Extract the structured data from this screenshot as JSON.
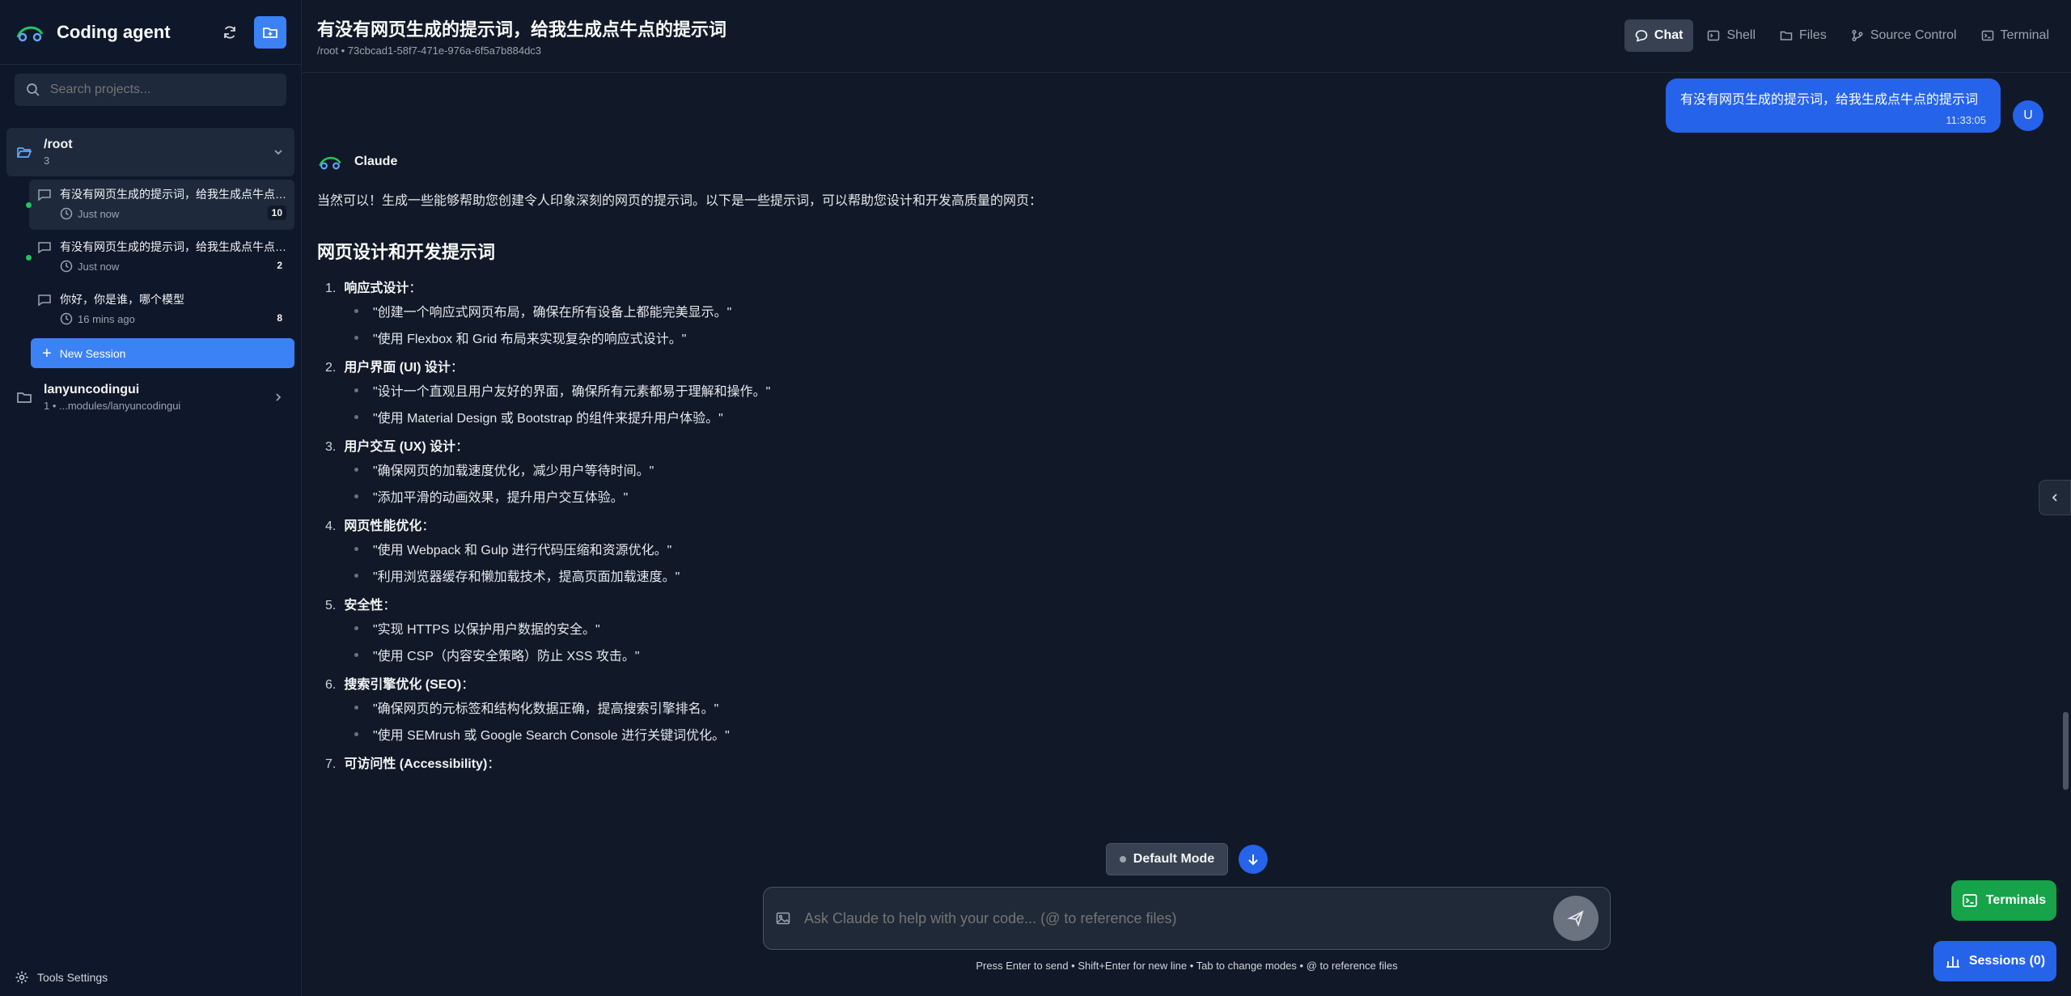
{
  "sidebar": {
    "app_title": "Coding agent",
    "search_placeholder": "Search projects...",
    "projects": [
      {
        "name": "/root",
        "count": "3"
      },
      {
        "name": "lanyuncodingui",
        "count": "1 • ...modules/lanyuncodingui"
      }
    ],
    "sessions": [
      {
        "title": "有没有网页生成的提示词，给我生成点牛点的提示词",
        "time": "Just now",
        "count": "10"
      },
      {
        "title": "有没有网页生成的提示词，给我生成点牛点的提示词",
        "time": "Just now",
        "count": "2"
      },
      {
        "title": "你好，你是谁，哪个模型",
        "time": "16 mins ago",
        "count": "8"
      }
    ],
    "new_session_label": "New Session",
    "tools_settings_label": "Tools Settings"
  },
  "header": {
    "title": "有没有网页生成的提示词，给我生成点牛点的提示词",
    "subtitle": "/root • 73cbcad1-58f7-471e-976a-6f5a7b884dc3",
    "tabs": [
      "Chat",
      "Shell",
      "Files",
      "Source Control",
      "Terminal"
    ]
  },
  "user_message": {
    "text": "有没有网页生成的提示词，给我生成点牛点的提示词",
    "time": "11:33:05",
    "avatar": "U"
  },
  "assistant": {
    "name": "Claude",
    "intro": "当然可以！生成一些能够帮助您创建令人印象深刻的网页的提示词。以下是一些提示词，可以帮助您设计和开发高质量的网页：",
    "heading": "网页设计和开发提示词",
    "items": [
      {
        "num": "1.",
        "title": "响应式设计",
        "bullets": [
          "\"创建一个响应式网页布局，确保在所有设备上都能完美显示。\"",
          "\"使用 Flexbox 和 Grid 布局来实现复杂的响应式设计。\""
        ]
      },
      {
        "num": "2.",
        "title": "用户界面 (UI) 设计",
        "bullets": [
          "\"设计一个直观且用户友好的界面，确保所有元素都易于理解和操作。\"",
          "\"使用 Material Design 或 Bootstrap 的组件来提升用户体验。\""
        ]
      },
      {
        "num": "3.",
        "title": "用户交互 (UX) 设计",
        "bullets": [
          "\"确保网页的加载速度优化，减少用户等待时间。\"",
          "\"添加平滑的动画效果，提升用户交互体验。\""
        ]
      },
      {
        "num": "4.",
        "title": "网页性能优化",
        "bullets": [
          "\"使用 Webpack 和 Gulp 进行代码压缩和资源优化。\"",
          "\"利用浏览器缓存和懒加载技术，提高页面加载速度。\""
        ]
      },
      {
        "num": "5.",
        "title": "安全性",
        "bullets": [
          "\"实现 HTTPS 以保护用户数据的安全。\"",
          "\"使用 CSP（内容安全策略）防止 XSS 攻击。\""
        ]
      },
      {
        "num": "6.",
        "title": "搜索引擎优化 (SEO)",
        "bullets": [
          "\"确保网页的元标签和结构化数据正确，提高搜索引擎排名。\"",
          "\"使用 SEMrush 或 Google Search Console 进行关键词优化。\""
        ]
      },
      {
        "num": "7.",
        "title": "可访问性 (Accessibility)",
        "bullets": []
      }
    ],
    "colon": "："
  },
  "composer": {
    "mode_label": "Default Mode",
    "placeholder": "Ask Claude to help with your code... (@ to reference files)",
    "hint": "Press Enter to send • Shift+Enter for new line • Tab to change modes • @ to reference files"
  },
  "floating": {
    "terminals_label": "Terminals",
    "sessions_label": "Sessions (0)"
  },
  "colors": {
    "accent": "#3b82f6",
    "success": "#16a34a",
    "background": "#111827",
    "sidebar": "#0f172a"
  }
}
